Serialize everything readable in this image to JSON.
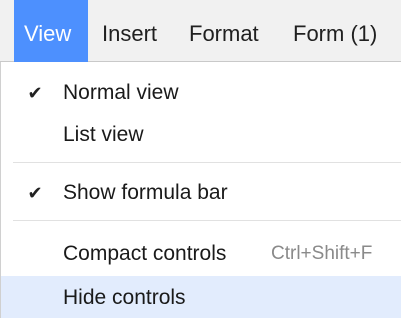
{
  "menubar": {
    "items": [
      {
        "label": "View",
        "active": true
      },
      {
        "label": "Insert",
        "active": false
      },
      {
        "label": "Format",
        "active": false
      },
      {
        "label": "Form (1)",
        "active": false
      }
    ]
  },
  "dropdown": {
    "items": [
      {
        "label": "Normal view",
        "checked": true,
        "check_glyph": "✔",
        "shortcut": ""
      },
      {
        "label": "List view",
        "checked": false,
        "shortcut": ""
      },
      {
        "label": "Show formula bar",
        "checked": true,
        "check_glyph": "✔",
        "shortcut": ""
      },
      {
        "label": "Compact controls",
        "checked": false,
        "shortcut": "Ctrl+Shift+F"
      },
      {
        "label": "Hide controls",
        "checked": false,
        "shortcut": "",
        "highlighted": true
      }
    ]
  },
  "colors": {
    "active_menu_bg": "#4d90fe",
    "menubar_bg": "#f1f1f1",
    "highlight_row_bg": "#e2ecfd",
    "shortcut_text": "#8a8a8a"
  },
  "icons": {
    "check": "checkmark-icon"
  }
}
